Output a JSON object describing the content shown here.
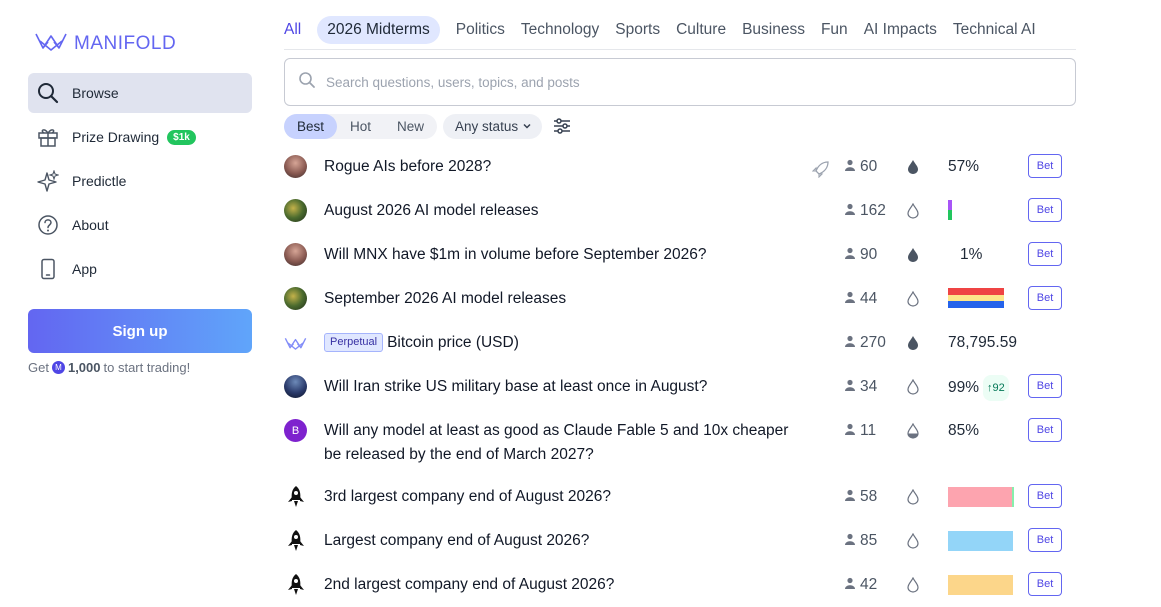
{
  "brand": {
    "name": "MANIFOLD"
  },
  "sidebar": {
    "items": [
      {
        "label": "Browse",
        "icon": "search-icon"
      },
      {
        "label": "Prize Drawing",
        "icon": "gift-icon",
        "badge": "$1k"
      },
      {
        "label": "Predictle",
        "icon": "sparkles-icon"
      },
      {
        "label": "About",
        "icon": "question-icon"
      },
      {
        "label": "App",
        "icon": "phone-icon"
      }
    ],
    "signup_label": "Sign up",
    "signup_note_prefix": "Get",
    "signup_note_amount": "1,000",
    "signup_note_suffix": "to start trading!"
  },
  "topics": [
    "All",
    "2026 Midterms",
    "Politics",
    "Technology",
    "Sports",
    "Culture",
    "Business",
    "Fun",
    "AI Impacts",
    "Technical AI"
  ],
  "search": {
    "placeholder": "Search questions, users, topics, and posts"
  },
  "filters": {
    "sorts": [
      "Best",
      "Hot",
      "New"
    ],
    "active_sort": "Best",
    "status": "Any status"
  },
  "markets": [
    {
      "title": "Rogue AIs before 2028?",
      "traders": "60",
      "prob": "57%",
      "bet": "Bet"
    },
    {
      "title": "August 2026 AI model releases",
      "traders": "162",
      "bet": "Bet"
    },
    {
      "title": "Will MNX have $1m in volume before September 2026?",
      "traders": "90",
      "prob": "1%",
      "bet": "Bet"
    },
    {
      "title": "September 2026 AI model releases",
      "traders": "44",
      "bet": "Bet"
    },
    {
      "badge": "Perpetual",
      "title": "Bitcoin price (USD)",
      "traders": "270",
      "prob": "78,795.59"
    },
    {
      "title": "Will Iran strike US military base at least once in August?",
      "traders": "34",
      "prob": "99%",
      "change": "92",
      "bet": "Bet"
    },
    {
      "avatar_letter": "B",
      "title": "Will any model at least as good as Claude Fable 5 and 10x cheaper be released by the end of March 2027?",
      "traders": "11",
      "prob": "85%",
      "bet": "Bet"
    },
    {
      "title": "3rd largest company end of August 2026?",
      "traders": "58",
      "bet": "Bet"
    },
    {
      "title": "Largest company end of August 2026?",
      "traders": "85",
      "bet": "Bet"
    },
    {
      "title": "2nd largest company end of August 2026?",
      "traders": "42",
      "bet": "Bet"
    }
  ],
  "colors": {
    "accent": "#4f46e5",
    "signup_gradient_start": "#6366f1",
    "signup_gradient_end": "#60a5fa",
    "prize_badge": "#22c55e",
    "bar_pink": "#fda4af",
    "bar_blue": "#93d5f8",
    "bar_yellow": "#fcd68a"
  }
}
